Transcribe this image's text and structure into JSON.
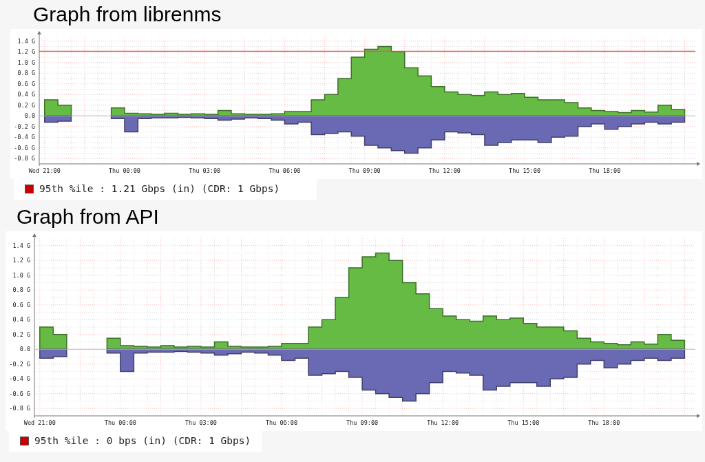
{
  "graphs": [
    {
      "title": "Graph from librenms",
      "chart_data": {
        "type": "area",
        "categories": [
          "Wed 21:00",
          null,
          null,
          null,
          null,
          null,
          "Thu 00:00",
          null,
          null,
          null,
          null,
          null,
          "Thu 03:00",
          null,
          null,
          null,
          null,
          null,
          "Thu 06:00",
          null,
          null,
          null,
          null,
          null,
          "Thu 09:00",
          null,
          null,
          null,
          null,
          null,
          "Thu 12:00",
          null,
          null,
          null,
          null,
          null,
          "Thu 15:00",
          null,
          null,
          null,
          null,
          null,
          "Thu 18:00",
          null,
          null,
          null,
          null,
          null
        ],
        "ylim": [
          -0.9,
          1.5
        ],
        "yticks": [
          {
            "value": 1.4,
            "label": "1.4 G"
          },
          {
            "value": 1.2,
            "label": "1.2 G"
          },
          {
            "value": 1.0,
            "label": "1.0 G"
          },
          {
            "value": 0.8,
            "label": "0.8 G"
          },
          {
            "value": 0.6,
            "label": "0.6 G"
          },
          {
            "value": 0.4,
            "label": "0.4 G"
          },
          {
            "value": 0.2,
            "label": "0.2 G"
          },
          {
            "value": 0,
            "label": "0.0"
          },
          {
            "value": -0.2,
            "label": "-0.2 G"
          },
          {
            "value": -0.4,
            "label": "-0.4 G"
          },
          {
            "value": -0.6,
            "label": "-0.6 G"
          },
          {
            "value": -0.8,
            "label": "-0.8 G"
          }
        ],
        "series": [
          {
            "color": "#66bb44",
            "values": [
              0.3,
              0.2,
              null,
              null,
              null,
              0.15,
              0.05,
              0.04,
              0.03,
              0.05,
              0.03,
              0.04,
              0.03,
              0.1,
              0.04,
              0.03,
              0.03,
              0.04,
              0.08,
              0.08,
              0.3,
              0.4,
              0.7,
              1.1,
              1.25,
              1.3,
              1.2,
              0.9,
              0.75,
              0.55,
              0.45,
              0.4,
              0.38,
              0.45,
              0.4,
              0.42,
              0.35,
              0.3,
              0.3,
              0.25,
              0.15,
              0.1,
              0.08,
              0.06,
              0.1,
              0.07,
              0.2,
              0.12
            ]
          },
          {
            "color": "#6a6ab4",
            "values": [
              -0.12,
              -0.1,
              null,
              null,
              null,
              -0.05,
              -0.3,
              -0.05,
              -0.04,
              -0.04,
              -0.03,
              -0.04,
              -0.05,
              -0.08,
              -0.06,
              -0.04,
              -0.05,
              -0.08,
              -0.15,
              -0.12,
              -0.35,
              -0.33,
              -0.3,
              -0.38,
              -0.55,
              -0.6,
              -0.65,
              -0.7,
              -0.6,
              -0.45,
              -0.3,
              -0.32,
              -0.35,
              -0.55,
              -0.5,
              -0.45,
              -0.45,
              -0.5,
              -0.4,
              -0.38,
              -0.2,
              -0.15,
              -0.25,
              -0.2,
              -0.15,
              -0.12,
              -0.15,
              -0.12
            ]
          }
        ],
        "grid": true,
        "ref_lines": [
          {
            "axis": "y",
            "value": 1.21
          }
        ]
      },
      "legend": {
        "text": "95th %ile : 1.21 Gbps (in) (CDR: 1 Gbps)",
        "color": "#cc0000"
      }
    },
    {
      "title": "Graph from API",
      "chart_data": {
        "type": "area",
        "grid": true,
        "categories": [
          "Wed 21:00",
          null,
          null,
          null,
          null,
          null,
          "Thu 00:00",
          null,
          null,
          null,
          null,
          null,
          "Thu 03:00",
          null,
          null,
          null,
          null,
          null,
          "Thu 06:00",
          null,
          null,
          null,
          null,
          null,
          "Thu 09:00",
          null,
          null,
          null,
          null,
          null,
          "Thu 12:00",
          null,
          null,
          null,
          null,
          null,
          "Thu 15:00",
          null,
          null,
          null,
          null,
          null,
          "Thu 18:00",
          null,
          null,
          null,
          null,
          null
        ],
        "ylim": [
          -0.9,
          1.5
        ],
        "yticks": [
          {
            "value": 1.4,
            "label": "1.4 G"
          },
          {
            "value": 1.2,
            "label": "1.2 G"
          },
          {
            "value": 1.0,
            "label": "1.0 G"
          },
          {
            "value": 0.8,
            "label": "0.8 G"
          },
          {
            "value": 0.6,
            "label": "0.6 G"
          },
          {
            "value": 0.4,
            "label": "0.4 G"
          },
          {
            "value": 0.2,
            "label": "0.2 G"
          },
          {
            "value": 0,
            "label": "0.0"
          },
          {
            "value": -0.2,
            "label": "-0.2 G"
          },
          {
            "value": -0.4,
            "label": "-0.4 G"
          },
          {
            "value": -0.6,
            "label": "-0.6 G"
          },
          {
            "value": -0.8,
            "label": "-0.8 G"
          }
        ],
        "series": [
          {
            "color": "#66bb44",
            "values": [
              0.3,
              0.2,
              null,
              null,
              null,
              0.15,
              0.05,
              0.04,
              0.03,
              0.05,
              0.03,
              0.04,
              0.03,
              0.1,
              0.04,
              0.03,
              0.03,
              0.04,
              0.08,
              0.08,
              0.3,
              0.4,
              0.7,
              1.1,
              1.25,
              1.3,
              1.2,
              0.9,
              0.75,
              0.55,
              0.45,
              0.4,
              0.38,
              0.45,
              0.4,
              0.42,
              0.35,
              0.3,
              0.3,
              0.25,
              0.15,
              0.1,
              0.08,
              0.06,
              0.1,
              0.07,
              0.2,
              0.12
            ]
          },
          {
            "color": "#6a6ab4",
            "values": [
              -0.12,
              -0.1,
              null,
              null,
              null,
              -0.05,
              -0.3,
              -0.05,
              -0.04,
              -0.04,
              -0.03,
              -0.04,
              -0.05,
              -0.08,
              -0.06,
              -0.04,
              -0.05,
              -0.08,
              -0.15,
              -0.12,
              -0.35,
              -0.33,
              -0.3,
              -0.38,
              -0.55,
              -0.6,
              -0.65,
              -0.7,
              -0.6,
              -0.45,
              -0.3,
              -0.32,
              -0.35,
              -0.55,
              -0.5,
              -0.45,
              -0.45,
              -0.5,
              -0.4,
              -0.38,
              -0.2,
              -0.15,
              -0.25,
              -0.2,
              -0.15,
              -0.12,
              -0.15,
              -0.12
            ]
          }
        ]
      },
      "legend": {
        "text": "95th %ile : 0 bps (in) (CDR: 1 Gbps)",
        "color": "#cc0000"
      }
    }
  ]
}
